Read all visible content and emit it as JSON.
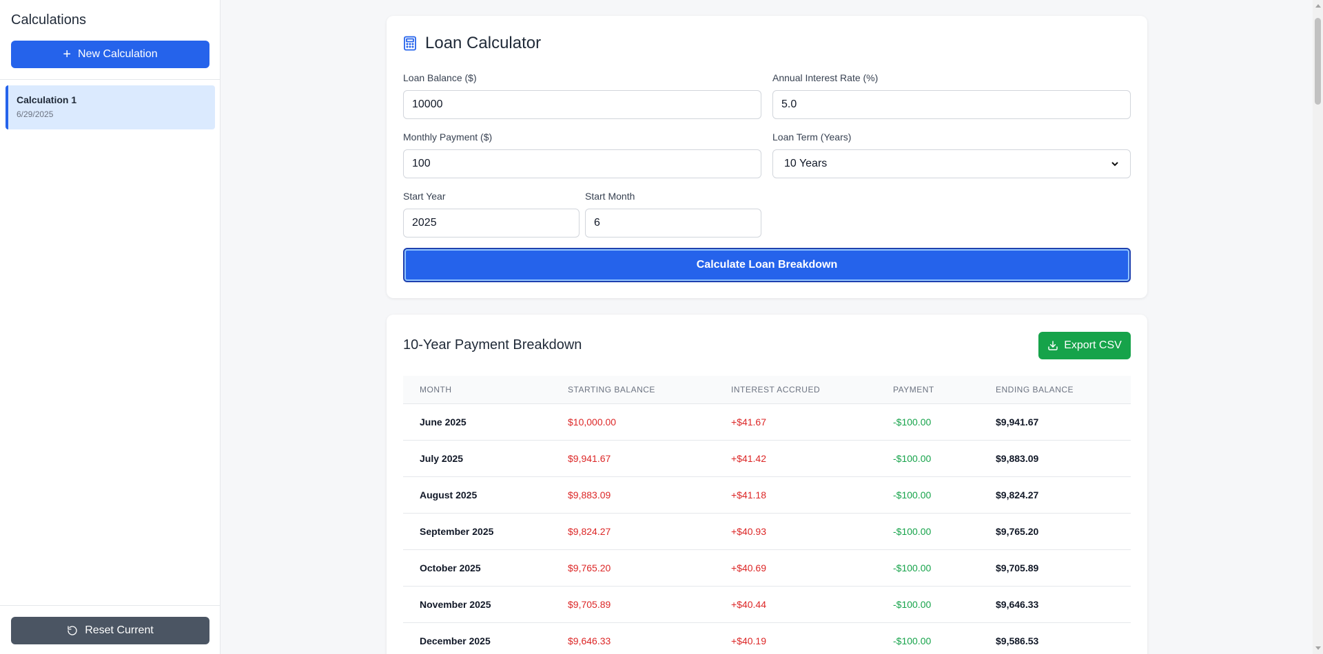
{
  "sidebar": {
    "title": "Calculations",
    "new_button": "New Calculation",
    "items": [
      {
        "name": "Calculation 1",
        "date": "6/29/2025"
      }
    ],
    "reset_button": "Reset Current"
  },
  "calculator": {
    "title": "Loan Calculator",
    "fields": {
      "loan_balance": {
        "label": "Loan Balance ($)",
        "value": "10000"
      },
      "interest_rate": {
        "label": "Annual Interest Rate (%)",
        "value": "5.0"
      },
      "monthly_payment": {
        "label": "Monthly Payment ($)",
        "value": "100"
      },
      "loan_term": {
        "label": "Loan Term (Years)",
        "value": "10 Years"
      },
      "start_year": {
        "label": "Start Year",
        "value": "2025"
      },
      "start_month": {
        "label": "Start Month",
        "value": "6"
      }
    },
    "calculate_button": "Calculate Loan Breakdown"
  },
  "breakdown": {
    "title": "10-Year Payment Breakdown",
    "export_button": "Export CSV",
    "columns": [
      "MONTH",
      "STARTING BALANCE",
      "INTEREST ACCRUED",
      "PAYMENT",
      "ENDING BALANCE"
    ],
    "rows": [
      [
        "June 2025",
        "$10,000.00",
        "+$41.67",
        "-$100.00",
        "$9,941.67"
      ],
      [
        "July 2025",
        "$9,941.67",
        "+$41.42",
        "-$100.00",
        "$9,883.09"
      ],
      [
        "August 2025",
        "$9,883.09",
        "+$41.18",
        "-$100.00",
        "$9,824.27"
      ],
      [
        "September 2025",
        "$9,824.27",
        "+$40.93",
        "-$100.00",
        "$9,765.20"
      ],
      [
        "October 2025",
        "$9,765.20",
        "+$40.69",
        "-$100.00",
        "$9,705.89"
      ],
      [
        "November 2025",
        "$9,705.89",
        "+$40.44",
        "-$100.00",
        "$9,646.33"
      ],
      [
        "December 2025",
        "$9,646.33",
        "+$40.19",
        "-$100.00",
        "$9,586.53"
      ]
    ]
  },
  "colors": {
    "accent": "#2563eb",
    "export": "#16a34a",
    "reset": "#4b5563",
    "negative": "#dc2626",
    "positive": "#16a34a"
  },
  "icons": {
    "calculator": "calculator-icon",
    "plus": "plus-icon",
    "reset": "rotate-ccw-icon",
    "download": "download-icon",
    "select": "chevron-down-icon"
  }
}
